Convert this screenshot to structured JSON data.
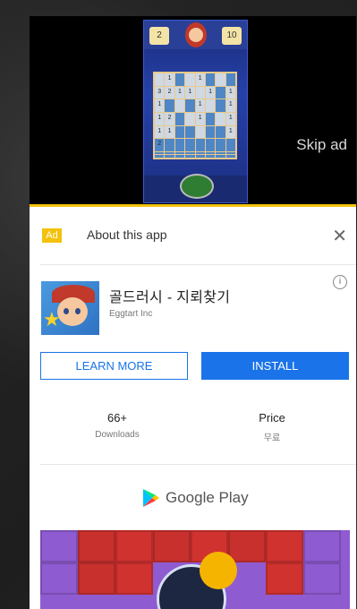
{
  "video": {
    "skip_label": "Skip ad",
    "game_preview": {
      "header_left": "2",
      "header_right": "10",
      "board_cells": [
        "",
        "1",
        "",
        "",
        "1",
        "",
        "",
        "",
        "3",
        "2",
        "1",
        "1",
        "",
        "1",
        "",
        "1",
        "1",
        "",
        "",
        "",
        "1",
        "",
        "",
        "1",
        "1",
        "2",
        "",
        "",
        "1",
        "",
        "",
        "1",
        "1",
        "1",
        "",
        "",
        "",
        "",
        "",
        "1",
        "2",
        "",
        "",
        "",
        "",
        "",
        "",
        "",
        "",
        "",
        "",
        "",
        "",
        "",
        "",
        "",
        "",
        "",
        "",
        "",
        "",
        "",
        "",
        ""
      ]
    }
  },
  "ad": {
    "badge": "Ad",
    "about_label": "About this app",
    "close_icon": "close-icon",
    "app_title": "골드러시 - 지뢰찾기",
    "developer": "Eggtart Inc",
    "info_icon": "info-icon",
    "learn_more_label": "LEARN MORE",
    "install_label": "INSTALL",
    "downloads_value": "66+",
    "downloads_label": "Downloads",
    "price_label_top": "Price",
    "price_value": "무료",
    "store_name": "Google Play"
  },
  "colors": {
    "accent": "#1a73e8",
    "ad_badge": "#f4c20d"
  }
}
